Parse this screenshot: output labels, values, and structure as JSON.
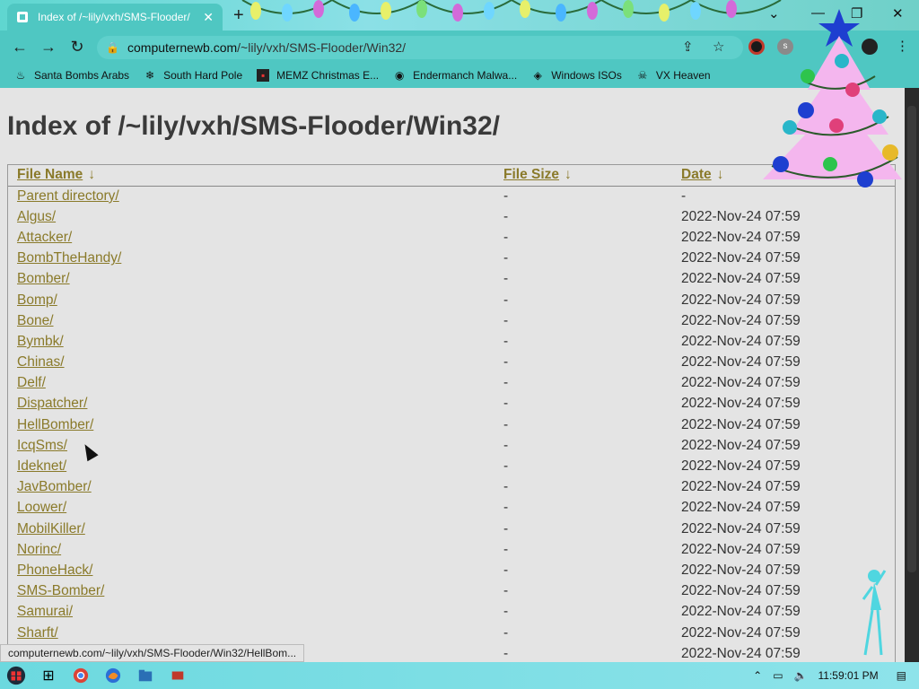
{
  "browser": {
    "tab_title": "Index of /~lily/vxh/SMS-Flooder/",
    "address_host": "computernewb.com",
    "address_path": "/~lily/vxh/SMS-Flooder/Win32/"
  },
  "bookmarks": [
    {
      "label": "Santa Bombs Arabs"
    },
    {
      "label": "South Hard Pole"
    },
    {
      "label": "MEMZ Christmas E..."
    },
    {
      "label": "Endermanch Malwa..."
    },
    {
      "label": "Windows ISOs"
    },
    {
      "label": "VX Heaven"
    }
  ],
  "page": {
    "heading": "Index of /~lily/vxh/SMS-Flooder/Win32/",
    "columns": {
      "name": "File Name",
      "size": "File Size",
      "date": "Date",
      "sort_glyph": "↓"
    },
    "rows": [
      {
        "name": "Parent directory/",
        "size": "-",
        "date": "-"
      },
      {
        "name": "Algus/",
        "size": "-",
        "date": "2022-Nov-24 07:59"
      },
      {
        "name": "Attacker/",
        "size": "-",
        "date": "2022-Nov-24 07:59"
      },
      {
        "name": "BombTheHandy/",
        "size": "-",
        "date": "2022-Nov-24 07:59"
      },
      {
        "name": "Bomber/",
        "size": "-",
        "date": "2022-Nov-24 07:59"
      },
      {
        "name": "Bomp/",
        "size": "-",
        "date": "2022-Nov-24 07:59"
      },
      {
        "name": "Bone/",
        "size": "-",
        "date": "2022-Nov-24 07:59"
      },
      {
        "name": "Bymbk/",
        "size": "-",
        "date": "2022-Nov-24 07:59"
      },
      {
        "name": "Chinas/",
        "size": "-",
        "date": "2022-Nov-24 07:59"
      },
      {
        "name": "Delf/",
        "size": "-",
        "date": "2022-Nov-24 07:59"
      },
      {
        "name": "Dispatcher/",
        "size": "-",
        "date": "2022-Nov-24 07:59"
      },
      {
        "name": "HellBomber/",
        "size": "-",
        "date": "2022-Nov-24 07:59"
      },
      {
        "name": "IcqSms/",
        "size": "-",
        "date": "2022-Nov-24 07:59"
      },
      {
        "name": "Ideknet/",
        "size": "-",
        "date": "2022-Nov-24 07:59"
      },
      {
        "name": "JavBomber/",
        "size": "-",
        "date": "2022-Nov-24 07:59"
      },
      {
        "name": "Loower/",
        "size": "-",
        "date": "2022-Nov-24 07:59"
      },
      {
        "name": "MobilKiller/",
        "size": "-",
        "date": "2022-Nov-24 07:59"
      },
      {
        "name": "Norinc/",
        "size": "-",
        "date": "2022-Nov-24 07:59"
      },
      {
        "name": "PhoneHack/",
        "size": "-",
        "date": "2022-Nov-24 07:59"
      },
      {
        "name": "SMS-Bomber/",
        "size": "-",
        "date": "2022-Nov-24 07:59"
      },
      {
        "name": "Samurai/",
        "size": "-",
        "date": "2022-Nov-24 07:59"
      },
      {
        "name": "Sharft/",
        "size": "-",
        "date": "2022-Nov-24 07:59"
      },
      {
        "name": "",
        "size": "-",
        "date": "2022-Nov-24 07:59"
      }
    ]
  },
  "status_bar": "computernewb.com/~lily/vxh/SMS-Flooder/Win32/HellBom...",
  "taskbar": {
    "clock": "11:59:01 PM"
  },
  "colors": {
    "link": "#8a7a2a",
    "chrome": "#4fc7c2",
    "taskbar": "#6cd9df"
  }
}
